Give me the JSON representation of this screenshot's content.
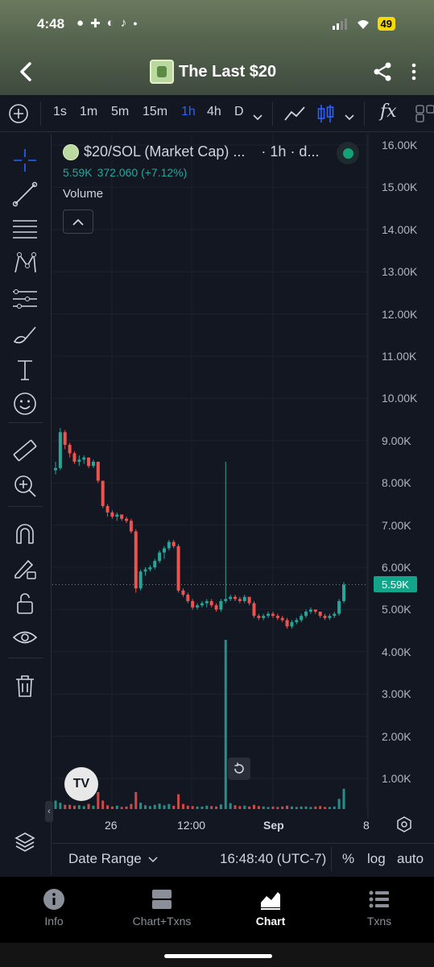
{
  "status": {
    "time": "4:48",
    "battery": "49"
  },
  "header": {
    "title": "The Last $20"
  },
  "toolbar": {
    "intervals": [
      "1s",
      "1m",
      "5m",
      "15m",
      "1h",
      "4h",
      "D"
    ],
    "active_interval": "1h",
    "fx_label": "fx"
  },
  "legend": {
    "symbol": "$20/SOL (Market Cap) ...",
    "meta": "· 1h · d...",
    "price": "5.59K",
    "change": "372.060 (+7.12%)",
    "volume_label": "Volume"
  },
  "price_tag": "5.59K",
  "y_axis": [
    "16.00K",
    "15.00K",
    "14.00K",
    "13.00K",
    "12.00K",
    "11.00K",
    "10.00K",
    "9.00K",
    "8.00K",
    "7.00K",
    "6.00K",
    "5.00K",
    "4.00K",
    "3.00K",
    "2.00K",
    "1.00K"
  ],
  "x_axis": [
    {
      "label": "26",
      "bold": false
    },
    {
      "label": "12:00",
      "bold": false
    },
    {
      "label": "Sep",
      "bold": true
    },
    {
      "label": "8",
      "bold": false
    }
  ],
  "bottom_bar": {
    "date_range": "Date Range",
    "time": "16:48:40 (UTC-7)",
    "percent": "%",
    "log": "log",
    "auto": "auto"
  },
  "nav": [
    {
      "label": "Info",
      "icon": "info-icon",
      "active": false
    },
    {
      "label": "Chart+Txns",
      "icon": "split-view-icon",
      "active": false
    },
    {
      "label": "Chart",
      "icon": "area-chart-icon",
      "active": true
    },
    {
      "label": "Txns",
      "icon": "list-icon",
      "active": false
    }
  ],
  "colors": {
    "up": "#26a69a",
    "down": "#ef5350",
    "accent": "#2962ff",
    "bg": "#131722"
  },
  "chart_data": {
    "type": "candlestick",
    "y_range": [
      0,
      16000
    ],
    "last_price": 5590,
    "candles": [
      [
        8300,
        8500,
        8200,
        8350
      ],
      [
        8350,
        9300,
        8300,
        9200
      ],
      [
        9200,
        9250,
        8800,
        8900
      ],
      [
        8900,
        8950,
        8600,
        8700
      ],
      [
        8700,
        8750,
        8450,
        8500
      ],
      [
        8500,
        8650,
        8400,
        8550
      ],
      [
        8550,
        8650,
        8450,
        8600
      ],
      [
        8600,
        8600,
        8350,
        8400
      ],
      [
        8400,
        8550,
        8350,
        8500
      ],
      [
        8500,
        8500,
        8000,
        8050
      ],
      [
        8050,
        8050,
        7400,
        7450
      ],
      [
        7450,
        7500,
        7200,
        7300
      ],
      [
        7300,
        7350,
        7150,
        7200
      ],
      [
        7200,
        7300,
        7100,
        7250
      ],
      [
        7250,
        7250,
        7100,
        7150
      ],
      [
        7150,
        7200,
        7050,
        7100
      ],
      [
        7100,
        7150,
        6800,
        6850
      ],
      [
        6850,
        6900,
        5400,
        5500
      ],
      [
        5500,
        5950,
        5450,
        5900
      ],
      [
        5900,
        6000,
        5800,
        5950
      ],
      [
        5950,
        6050,
        5900,
        6000
      ],
      [
        6000,
        6200,
        5950,
        6150
      ],
      [
        6150,
        6400,
        6100,
        6350
      ],
      [
        6350,
        6500,
        6200,
        6450
      ],
      [
        6450,
        6650,
        6400,
        6600
      ],
      [
        6600,
        6650,
        6450,
        6500
      ],
      [
        6500,
        6550,
        5400,
        5450
      ],
      [
        5450,
        5500,
        5300,
        5350
      ],
      [
        5350,
        5400,
        5150,
        5200
      ],
      [
        5200,
        5250,
        5000,
        5050
      ],
      [
        5050,
        5150,
        5000,
        5100
      ],
      [
        5100,
        5200,
        5050,
        5150
      ],
      [
        5150,
        5250,
        5050,
        5200
      ],
      [
        5200,
        5250,
        5050,
        5100
      ],
      [
        5100,
        5150,
        4950,
        5000
      ],
      [
        5000,
        5250,
        4950,
        5200
      ],
      [
        5200,
        8500,
        5150,
        5250
      ],
      [
        5250,
        5350,
        5200,
        5300
      ],
      [
        5300,
        5350,
        5200,
        5250
      ],
      [
        5250,
        5300,
        5150,
        5200
      ],
      [
        5200,
        5350,
        5150,
        5300
      ],
      [
        5300,
        5300,
        5100,
        5150
      ],
      [
        5150,
        5200,
        4800,
        4850
      ],
      [
        4850,
        4900,
        4750,
        4800
      ],
      [
        4800,
        4900,
        4750,
        4850
      ],
      [
        4850,
        4950,
        4800,
        4900
      ],
      [
        4900,
        4950,
        4800,
        4850
      ],
      [
        4850,
        4900,
        4750,
        4800
      ],
      [
        4800,
        4850,
        4700,
        4750
      ],
      [
        4750,
        4800,
        4550,
        4600
      ],
      [
        4600,
        4750,
        4550,
        4700
      ],
      [
        4700,
        4800,
        4650,
        4750
      ],
      [
        4750,
        4900,
        4700,
        4850
      ],
      [
        4850,
        5000,
        4800,
        4950
      ],
      [
        4950,
        5050,
        4900,
        5000
      ],
      [
        5000,
        5000,
        4900,
        4950
      ],
      [
        4950,
        4950,
        4800,
        4850
      ],
      [
        4850,
        4900,
        4750,
        4800
      ],
      [
        4800,
        4900,
        4750,
        4850
      ],
      [
        4850,
        4950,
        4800,
        4900
      ],
      [
        4900,
        5250,
        4850,
        5200
      ],
      [
        5200,
        5650,
        5150,
        5590
      ]
    ],
    "volumes": [
      200,
      150,
      100,
      100,
      80,
      90,
      70,
      120,
      80,
      400,
      200,
      90,
      60,
      80,
      50,
      60,
      120,
      400,
      150,
      90,
      70,
      100,
      130,
      90,
      120,
      80,
      350,
      120,
      80,
      70,
      60,
      60,
      80,
      70,
      60,
      110,
      4000,
      140,
      90,
      70,
      80,
      60,
      100,
      70,
      60,
      50,
      60,
      50,
      60,
      80,
      60,
      50,
      60,
      60,
      50,
      60,
      70,
      50,
      50,
      60,
      240,
      480
    ]
  }
}
